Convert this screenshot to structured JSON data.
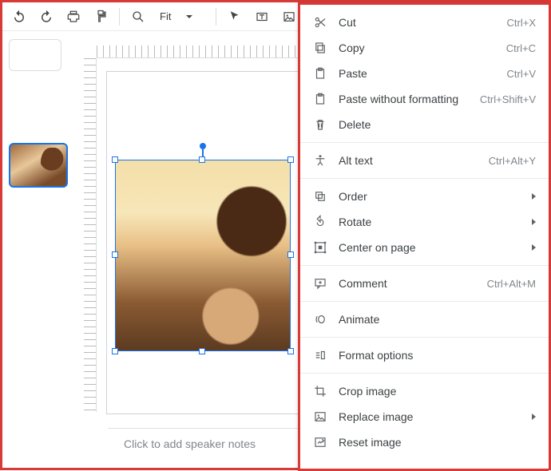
{
  "toolbar": {
    "zoom_label": "Fit"
  },
  "filmstrip": {
    "selected": 1
  },
  "notes": {
    "placeholder": "Click to add speaker notes"
  },
  "context_menu": [
    {
      "id": "cut",
      "label": "Cut",
      "shortcut": "Ctrl+X",
      "icon": "scissors"
    },
    {
      "id": "copy",
      "label": "Copy",
      "shortcut": "Ctrl+C",
      "icon": "copy"
    },
    {
      "id": "paste",
      "label": "Paste",
      "shortcut": "Ctrl+V",
      "icon": "clipboard"
    },
    {
      "id": "paste-nf",
      "label": "Paste without formatting",
      "shortcut": "Ctrl+Shift+V",
      "icon": "clipboard"
    },
    {
      "id": "delete",
      "label": "Delete",
      "shortcut": "",
      "icon": "trash"
    },
    {
      "sep": true
    },
    {
      "id": "alttext",
      "label": "Alt text",
      "shortcut": "Ctrl+Alt+Y",
      "icon": "accessibility"
    },
    {
      "sep": true
    },
    {
      "id": "order",
      "label": "Order",
      "submenu": true,
      "icon": "order"
    },
    {
      "id": "rotate",
      "label": "Rotate",
      "submenu": true,
      "icon": "rotate"
    },
    {
      "id": "center",
      "label": "Center on page",
      "submenu": true,
      "icon": "center"
    },
    {
      "sep": true
    },
    {
      "id": "comment",
      "label": "Comment",
      "shortcut": "Ctrl+Alt+M",
      "icon": "comment"
    },
    {
      "sep": true
    },
    {
      "id": "animate",
      "label": "Animate",
      "shortcut": "",
      "icon": "motion"
    },
    {
      "sep": true
    },
    {
      "id": "format",
      "label": "Format options",
      "shortcut": "",
      "icon": "format"
    },
    {
      "sep": true
    },
    {
      "id": "crop",
      "label": "Crop image",
      "shortcut": "",
      "icon": "crop"
    },
    {
      "id": "replace",
      "label": "Replace image",
      "submenu": true,
      "icon": "image"
    },
    {
      "id": "reset",
      "label": "Reset image",
      "shortcut": "",
      "icon": "reset-image"
    }
  ]
}
